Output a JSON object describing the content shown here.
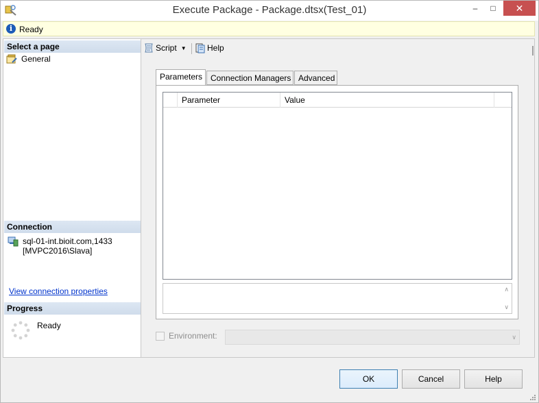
{
  "window": {
    "title": "Execute Package - Package.dtsx(Test_01)",
    "minimize_glyph": "–",
    "maximize_glyph": "□",
    "close_glyph": "✕"
  },
  "status": {
    "text": "Ready",
    "icon": "info-icon",
    "info_glyph": "i"
  },
  "left": {
    "select_page_header": "Select a page",
    "pages": [
      {
        "label": "General",
        "icon": "properties-page-icon"
      }
    ],
    "connection_header": "Connection",
    "connection": {
      "server": "sql-01-int.bioit.com,1433",
      "user": "[MVPC2016\\Slava]",
      "view_link": "View connection properties",
      "icon": "server-connection-icon"
    },
    "progress_header": "Progress",
    "progress_status": "Ready",
    "progress_icon": "spinner-icon"
  },
  "toolbar": {
    "script_label": "Script",
    "script_caret": "▼",
    "help_label": "Help"
  },
  "tabs": [
    {
      "label": "Parameters",
      "active": true
    },
    {
      "label": "Connection Managers",
      "active": false
    },
    {
      "label": "Advanced",
      "active": false
    }
  ],
  "grid": {
    "columns": [
      "Parameter",
      "Value"
    ],
    "rows": []
  },
  "description_box": {
    "scroll_up": "∧",
    "scroll_down": "∨"
  },
  "environment": {
    "label": "Environment:",
    "checked": false,
    "enabled": false,
    "selected_value": "",
    "dropdown_caret": "∨"
  },
  "buttons": {
    "ok": "OK",
    "cancel": "Cancel",
    "help": "Help"
  },
  "colors": {
    "status_bg": "#ffffe1",
    "section_header": "#d6e2f0",
    "close_button": "#c75050",
    "link": "#0033cc",
    "ok_border": "#3c7fb1"
  }
}
